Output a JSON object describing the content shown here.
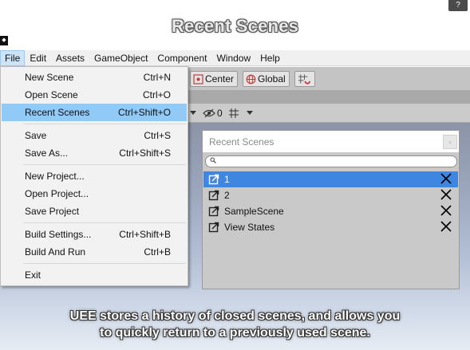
{
  "overlay_title": "Recent Scenes",
  "help_label": "?",
  "menubar": {
    "items": [
      "File",
      "Edit",
      "Assets",
      "GameObject",
      "Component",
      "Window",
      "Help"
    ],
    "active": "File"
  },
  "toolbar": {
    "center_label": "Center",
    "global_label": "Global"
  },
  "scenebar": {
    "visibility_count": "0"
  },
  "file_menu": {
    "items": [
      {
        "label": "New Scene",
        "shortcut": "Ctrl+N"
      },
      {
        "label": "Open Scene",
        "shortcut": "Ctrl+O"
      },
      {
        "label": "Recent Scenes",
        "shortcut": "Ctrl+Shift+O",
        "highlighted": true
      },
      {
        "label": "Save",
        "shortcut": "Ctrl+S"
      },
      {
        "label": "Save As...",
        "shortcut": "Ctrl+Shift+S"
      },
      {
        "label": "New Project...",
        "shortcut": ""
      },
      {
        "label": "Open Project...",
        "shortcut": ""
      },
      {
        "label": "Save Project",
        "shortcut": ""
      },
      {
        "label": "Build Settings...",
        "shortcut": "Ctrl+Shift+B"
      },
      {
        "label": "Build And Run",
        "shortcut": "Ctrl+B"
      },
      {
        "label": "Exit",
        "shortcut": ""
      }
    ]
  },
  "recent_scenes_window": {
    "title": "Recent Scenes",
    "search_placeholder": "",
    "items": [
      {
        "name": "1",
        "selected": true
      },
      {
        "name": "2"
      },
      {
        "name": "SampleScene"
      },
      {
        "name": "View States"
      }
    ]
  },
  "caption": {
    "line1": "UEE stores a history of closed scenes, and allows you",
    "line2": "to quickly return to a previously used scene."
  },
  "colors": {
    "menu_highlight": "#91c9f7",
    "list_selection": "#3f86e0",
    "toolbar_bg": "#c4c4c4"
  }
}
